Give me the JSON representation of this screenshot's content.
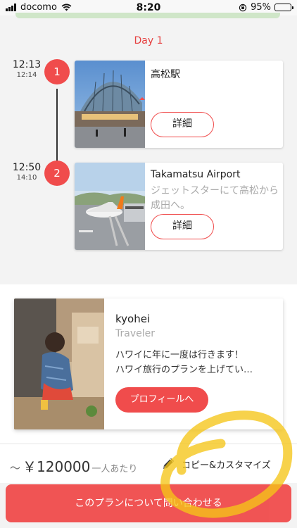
{
  "status_bar": {
    "carrier": "docomo",
    "time": "8:20",
    "battery": "95%"
  },
  "day": {
    "label": "Day 1"
  },
  "stops": [
    {
      "number": "1",
      "time_main": "12:13",
      "time_sub": "12:14",
      "title": "高松駅",
      "description": "",
      "detail_label": "詳細",
      "image": "station-photo"
    },
    {
      "number": "2",
      "time_main": "12:50",
      "time_sub": "14:10",
      "title": "Takamatsu Airport",
      "description": "ジェットスターにて高松から成田へ。",
      "detail_label": "詳細",
      "image": "airport-photo"
    }
  ],
  "profile": {
    "name": "kyohei",
    "role": "Traveler",
    "bio": "ハワイに年に一度は行きます！\nハワイ旅行のプランを上げてい…",
    "button_label": "プロフィールへ",
    "image": "child-photo"
  },
  "price_bar": {
    "tilde": "～",
    "price": "￥120000",
    "per_person": "一人あたり",
    "customize_label": "コピー&カスタマイズ",
    "customize_icon": "pencil-icon"
  },
  "contact": {
    "label": "このプランについて問い合わせる"
  },
  "colors": {
    "accent": "#f04c4c",
    "highlight": "#f5c518"
  }
}
